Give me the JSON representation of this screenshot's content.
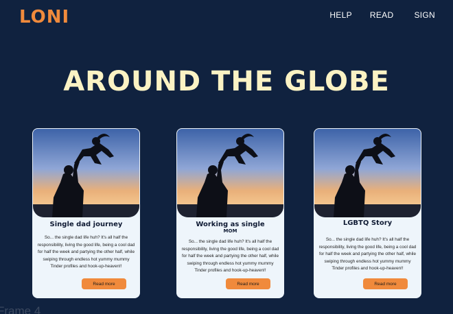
{
  "header": {
    "logo": "LONI",
    "nav": [
      "HELP",
      "READ",
      "SIGN"
    ]
  },
  "hero": {
    "title": "AROUND THE GLOBE"
  },
  "cards": [
    {
      "title": "Single dad journey",
      "title_line2": "",
      "body": "So... the single dad life huh? It's all half the responsibility, living the good life, being a cool dad for half the week and partying the other half, while swiping through endless hot yummy mummy Tinder profiles and hook-up-heaven!!",
      "button": "Read more"
    },
    {
      "title": "Working as single",
      "title_line2": "MOM",
      "body": "So... the single dad life huh? It's all half the responsibility, living the good life, being a cool dad for half the week and partying the other half, while swiping through endless hot yummy mummy Tinder profiles and hook-up-heaven!!",
      "button": "Read more"
    },
    {
      "title": "LGBTQ Story",
      "title_line2": "",
      "body": "So... the single dad life huh? It's all half the responsibility, living the good life, being a cool dad for half the week and partying the other half, while swiping through endless hot yummy mummy Tinder profiles and hook-up-heaven!!",
      "button": "Read more"
    }
  ],
  "frame_label": "Frame 4",
  "colors": {
    "background": "#10223f",
    "accent": "#f08a3c",
    "hero_text": "#fbf3c4",
    "card_bg": "#eef5fb"
  }
}
